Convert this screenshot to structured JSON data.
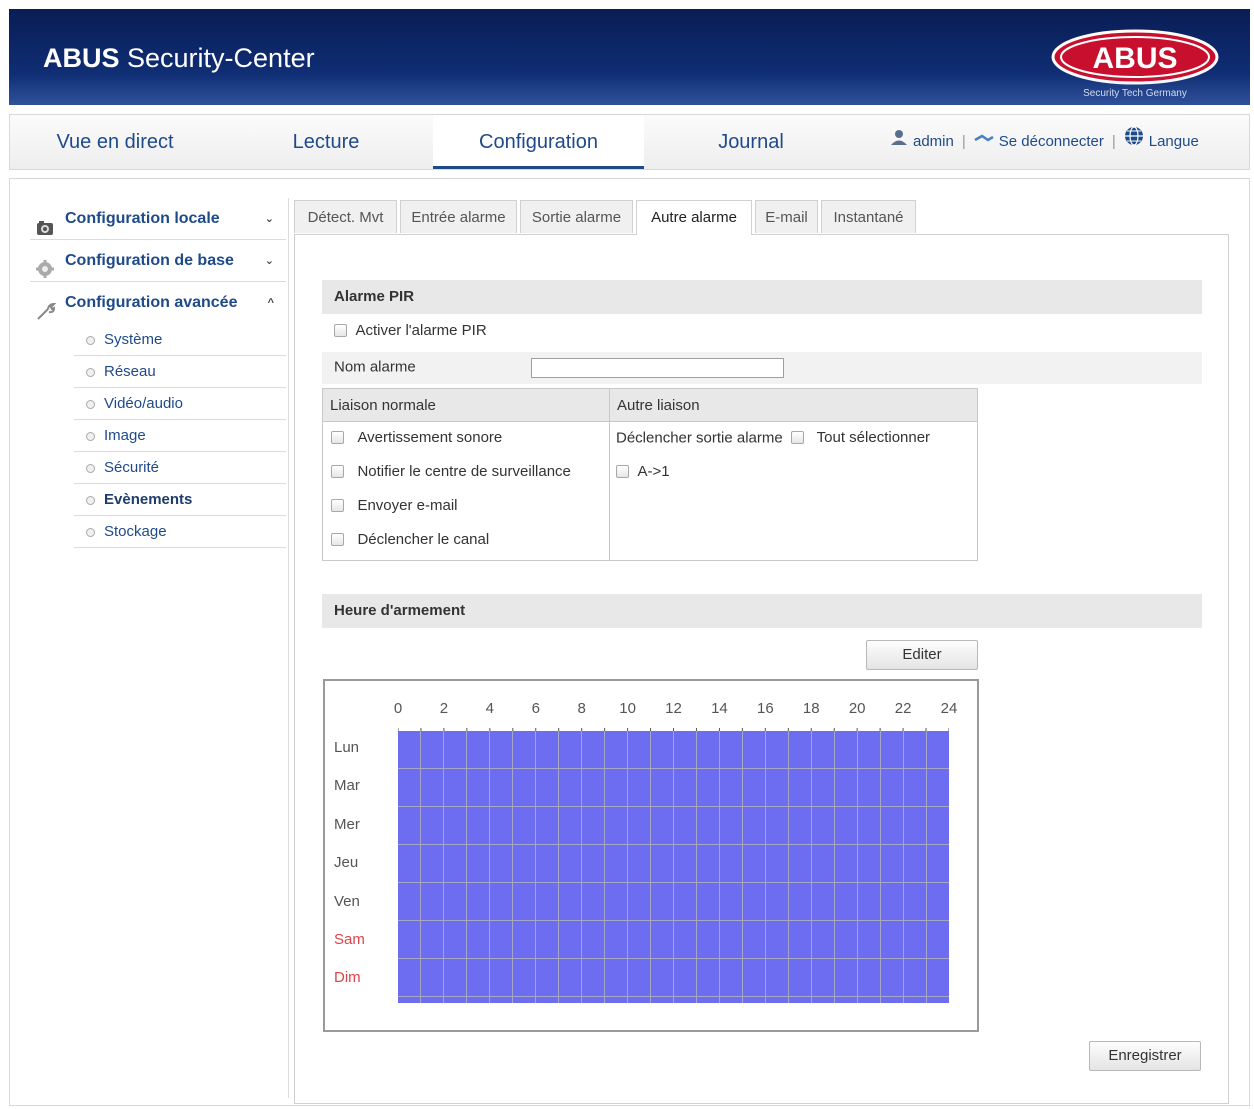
{
  "header": {
    "app_title_bold": "ABUS",
    "app_title_rest": " Security-Center",
    "logo_text": "ABUS",
    "logo_tagline": "Security Tech Germany",
    "brand_red": "#c8102e",
    "brand_navy": "#0e2a6e"
  },
  "topnav": {
    "tabs": [
      {
        "label": "Vue en direct",
        "active": false
      },
      {
        "label": "Lecture",
        "active": false
      },
      {
        "label": "Configuration",
        "active": true
      },
      {
        "label": "Journal",
        "active": false
      }
    ],
    "user": "admin",
    "logout": "Se déconnecter",
    "language": "Langue",
    "separator": "|"
  },
  "sidebar": {
    "groups": [
      {
        "label": "Configuration locale",
        "icon": "camera-icon",
        "chevron": "⌄"
      },
      {
        "label": "Configuration de base",
        "icon": "gear-icon",
        "chevron": "⌄"
      },
      {
        "label": "Configuration avancée",
        "icon": "wrench-icon",
        "chevron": "^"
      }
    ],
    "items": [
      {
        "label": "Système"
      },
      {
        "label": "Réseau"
      },
      {
        "label": "Vidéo/audio"
      },
      {
        "label": "Image"
      },
      {
        "label": "Sécurité"
      },
      {
        "label": "Evènements",
        "active": true
      },
      {
        "label": "Stockage"
      }
    ]
  },
  "subtabs": [
    {
      "label": "Détect. Mvt"
    },
    {
      "label": "Entrée alarme"
    },
    {
      "label": "Sortie alarme"
    },
    {
      "label": "Autre alarme",
      "active": true
    },
    {
      "label": "E-mail"
    },
    {
      "label": "Instantané"
    }
  ],
  "pir": {
    "section_title": "Alarme PIR",
    "enable_label": "Activer l'alarme PIR",
    "name_label": "Nom alarme",
    "name_value": ""
  },
  "linkage": {
    "normal_header": "Liaison normale",
    "other_header": "Autre liaison",
    "normal_items": [
      {
        "label": "Avertissement sonore"
      },
      {
        "label": "Notifier le centre de surveillance"
      },
      {
        "label": "Envoyer e-mail"
      },
      {
        "label": "Déclencher le canal"
      }
    ],
    "trigger_output_label": "Déclencher sortie alarme",
    "select_all_label": "Tout sélectionner",
    "output_item": "A->1"
  },
  "schedule": {
    "section_title": "Heure d'armement",
    "edit_button": "Editer",
    "hours": [
      "0",
      "2",
      "4",
      "6",
      "8",
      "10",
      "12",
      "14",
      "16",
      "18",
      "20",
      "22",
      "24"
    ],
    "days": [
      {
        "label": "Lun",
        "weekend": false
      },
      {
        "label": "Mar",
        "weekend": false
      },
      {
        "label": "Mer",
        "weekend": false
      },
      {
        "label": "Jeu",
        "weekend": false
      },
      {
        "label": "Ven",
        "weekend": false
      },
      {
        "label": "Sam",
        "weekend": true
      },
      {
        "label": "Dim",
        "weekend": true
      }
    ],
    "armed_all_week": true,
    "armed_color": "#6d6df2",
    "weekend_color": "#e0434a"
  },
  "save_button": "Enregistrer"
}
